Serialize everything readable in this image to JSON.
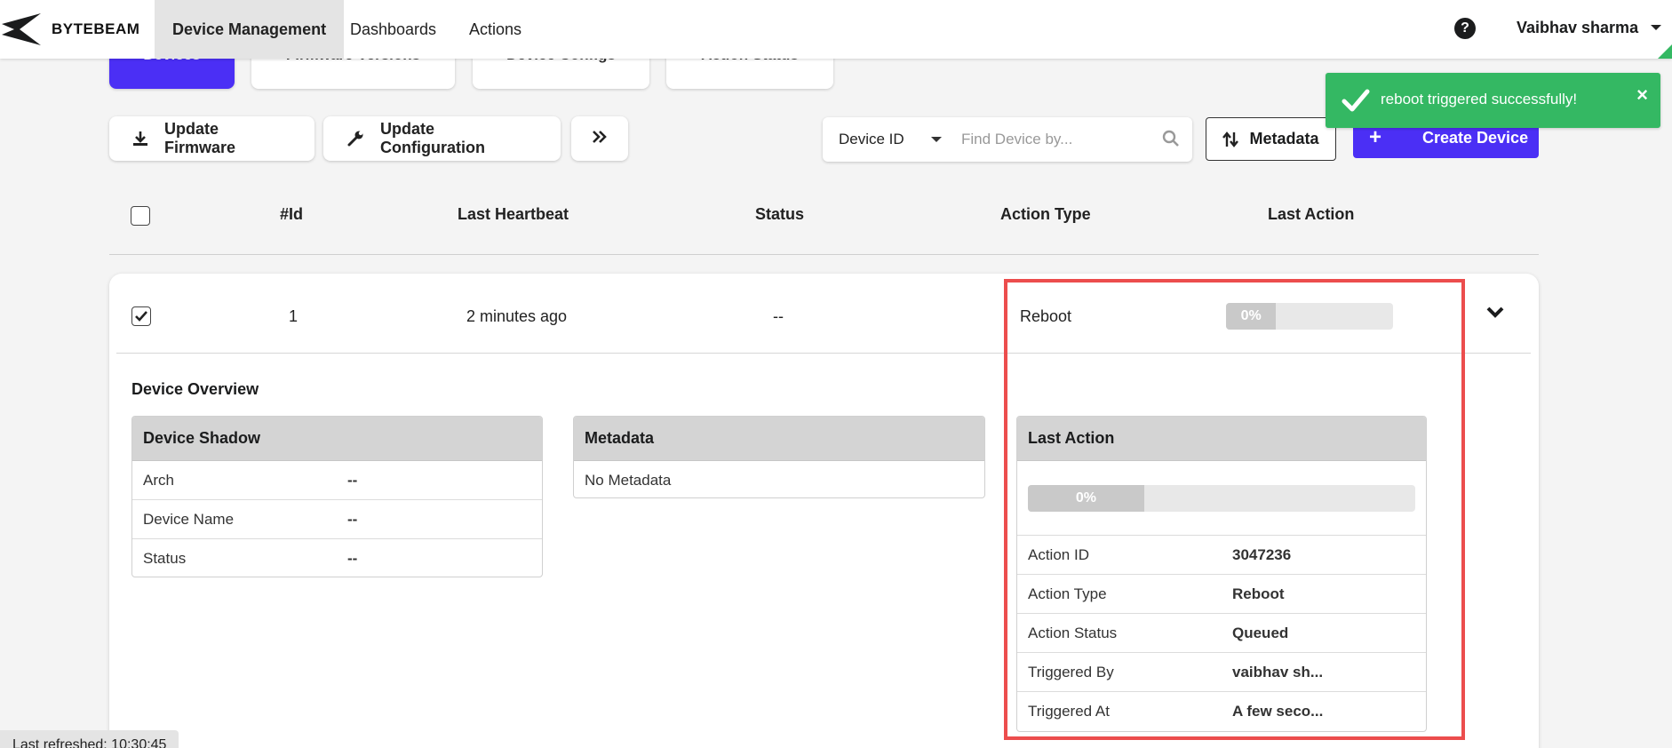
{
  "app": {
    "logo_text": "BYTEBEAM",
    "nav_tabs": [
      "Device Management",
      "Dashboards",
      "Actions"
    ],
    "active_tab": "Device Management",
    "user_name": "Vaibhav sharma"
  },
  "subtabs": [
    "Devices",
    "Firmware Versions",
    "Device Configs",
    "Action Status"
  ],
  "toolbar": {
    "update_firmware": "Update Firmware",
    "update_configuration": "Update Configuration",
    "search_select": "Device ID",
    "search_placeholder": "Find Device by...",
    "metadata": "Metadata",
    "create_device": "Create Device"
  },
  "table": {
    "headers": [
      "#Id",
      "Last Heartbeat",
      "Status",
      "Action Type",
      "Last Action"
    ],
    "row": {
      "id": "1",
      "last_heartbeat": "2 minutes ago",
      "status": "--",
      "action_type": "Reboot",
      "progress_percent": 0,
      "progress_label": "0%"
    }
  },
  "overview": {
    "title": "Device Overview",
    "device_shadow": {
      "title": "Device Shadow",
      "rows": [
        {
          "key": "Arch",
          "value": "--"
        },
        {
          "key": "Device Name",
          "value": "--"
        },
        {
          "key": "Status",
          "value": "--"
        }
      ]
    },
    "metadata": {
      "title": "Metadata",
      "empty_text": "No Metadata"
    },
    "last_action": {
      "title": "Last Action",
      "progress_label": "0%",
      "rows": [
        {
          "key": "Action ID",
          "value": "3047236"
        },
        {
          "key": "Action Type",
          "value": "Reboot"
        },
        {
          "key": "Action Status",
          "value": "Queued"
        },
        {
          "key": "Triggered By",
          "value": "vaibhav sh..."
        },
        {
          "key": "Triggered At",
          "value": "A few seco..."
        }
      ]
    }
  },
  "toast": {
    "message": "reboot triggered successfully!",
    "close": "×"
  },
  "footer": {
    "last_refreshed": "Last refreshed: 10:30:45"
  },
  "colors": {
    "primary": "#4b2ff5",
    "success": "#34b863",
    "highlight": "#ec4d4d"
  }
}
